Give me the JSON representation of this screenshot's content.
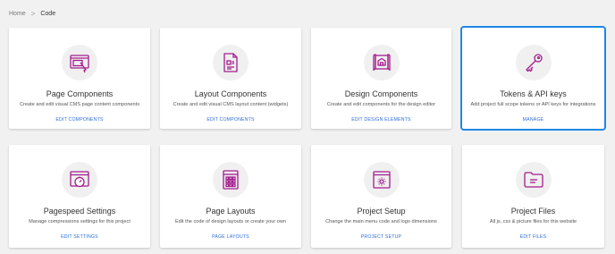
{
  "breadcrumb": {
    "home": "Home",
    "separator": ">",
    "current": "Code"
  },
  "colors": {
    "icon": "#a31c8d",
    "accent": "#2a6edb",
    "selected_border": "#1e88e5"
  },
  "cards": [
    {
      "title": "Page Components",
      "description": "Create and edit visual CMS page content components",
      "action": "EDIT COMPONENTS",
      "icon": "page-components-icon"
    },
    {
      "title": "Layout Components",
      "description": "Create and edit visual CMS layout content (widgets)",
      "action": "EDIT COMPONENTS",
      "icon": "layout-components-icon"
    },
    {
      "title": "Design Components",
      "description": "Create and edit components for the design editor",
      "action": "EDIT DESIGN ELEMENTS",
      "icon": "design-components-icon"
    },
    {
      "title": "Tokens & API keys",
      "description": "Add project full scope tokens or API keys for integrations",
      "action": "MANAGE",
      "icon": "key-icon",
      "selected": true
    },
    {
      "title": "Pagespeed Settings",
      "description": "Manage compressions settings for this project",
      "action": "EDIT SETTINGS",
      "icon": "pagespeed-icon"
    },
    {
      "title": "Page Layouts",
      "description": "Edit the code of design layouts or create your own",
      "action": "PAGE LAYOUTS",
      "icon": "page-layouts-icon"
    },
    {
      "title": "Project Setup",
      "description": "Change the main menu code and logo dimensions",
      "action": "PROJECT SETUP",
      "icon": "project-setup-icon"
    },
    {
      "title": "Project Files",
      "description": "All js, css & picture files for this website",
      "action": "EDIT FILES",
      "icon": "folder-icon"
    }
  ]
}
